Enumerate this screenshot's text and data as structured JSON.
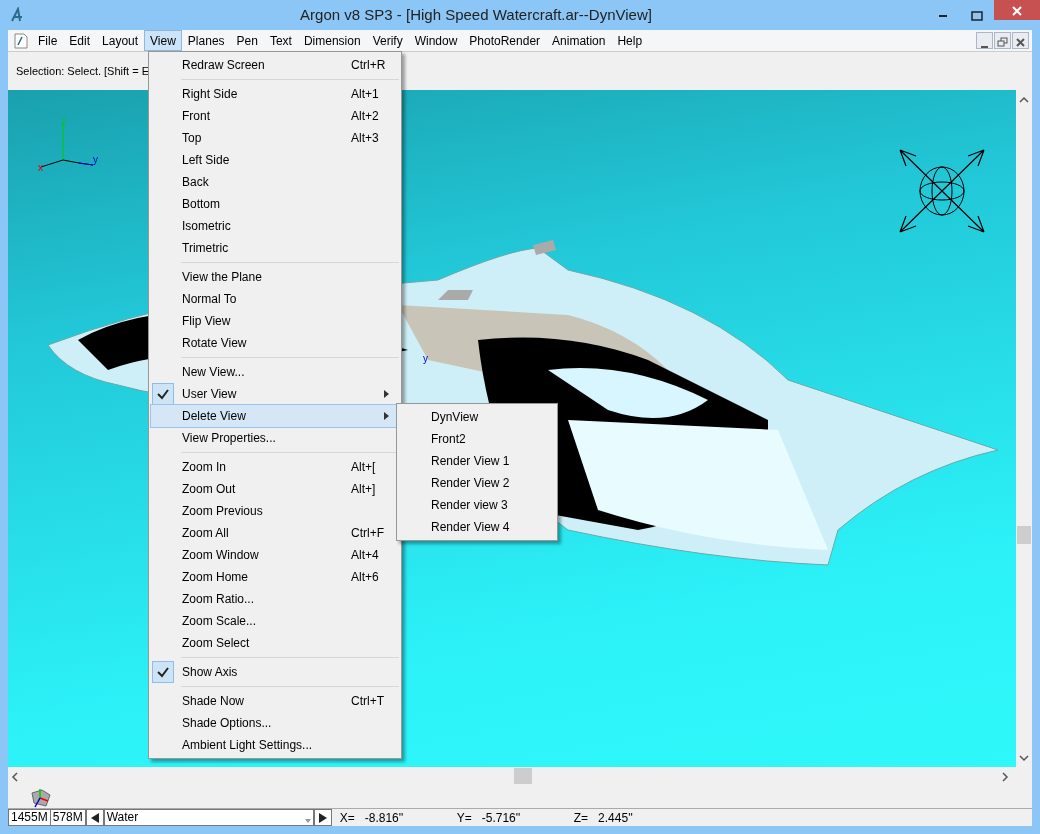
{
  "window": {
    "title": "Argon v8 SP3 - [High Speed Watercraft.ar--DynView]"
  },
  "menubar": [
    {
      "label": "File",
      "selected": false
    },
    {
      "label": "Edit",
      "selected": false
    },
    {
      "label": "Layout",
      "selected": false
    },
    {
      "label": "View",
      "selected": true
    },
    {
      "label": "Planes",
      "selected": false
    },
    {
      "label": "Pen",
      "selected": false
    },
    {
      "label": "Text",
      "selected": false
    },
    {
      "label": "Dimension",
      "selected": false
    },
    {
      "label": "Verify",
      "selected": false
    },
    {
      "label": "Window",
      "selected": false
    },
    {
      "label": "PhotoRender",
      "selected": false
    },
    {
      "label": "Animation",
      "selected": false
    },
    {
      "label": "Help",
      "selected": false
    }
  ],
  "prompt": "Selection: Select. [Shift = E",
  "view_menu": [
    {
      "kind": "item",
      "label": "Redraw Screen",
      "shortcut": "Ctrl+R",
      "checked": false,
      "highlighted": false,
      "submenu": false
    },
    {
      "kind": "separator"
    },
    {
      "kind": "item",
      "label": "Right Side",
      "shortcut": "Alt+1",
      "checked": false,
      "highlighted": false,
      "submenu": false
    },
    {
      "kind": "item",
      "label": "Front",
      "shortcut": "Alt+2",
      "checked": false,
      "highlighted": false,
      "submenu": false
    },
    {
      "kind": "item",
      "label": "Top",
      "shortcut": "Alt+3",
      "checked": false,
      "highlighted": false,
      "submenu": false
    },
    {
      "kind": "item",
      "label": "Left Side",
      "checked": false,
      "highlighted": false,
      "submenu": false
    },
    {
      "kind": "item",
      "label": "Back",
      "checked": false,
      "highlighted": false,
      "submenu": false
    },
    {
      "kind": "item",
      "label": "Bottom",
      "checked": false,
      "highlighted": false,
      "submenu": false
    },
    {
      "kind": "item",
      "label": "Isometric",
      "checked": false,
      "highlighted": false,
      "submenu": false
    },
    {
      "kind": "item",
      "label": "Trimetric",
      "checked": false,
      "highlighted": false,
      "submenu": false
    },
    {
      "kind": "separator"
    },
    {
      "kind": "item",
      "label": "View the Plane",
      "checked": false,
      "highlighted": false,
      "submenu": false
    },
    {
      "kind": "item",
      "label": "Normal To",
      "checked": false,
      "highlighted": false,
      "submenu": false
    },
    {
      "kind": "item",
      "label": "Flip View",
      "checked": false,
      "highlighted": false,
      "submenu": false
    },
    {
      "kind": "item",
      "label": "Rotate View",
      "checked": false,
      "highlighted": false,
      "submenu": false
    },
    {
      "kind": "separator"
    },
    {
      "kind": "item",
      "label": "New View...",
      "checked": false,
      "highlighted": false,
      "submenu": false
    },
    {
      "kind": "item",
      "label": "User View",
      "checked": true,
      "highlighted": false,
      "submenu": true
    },
    {
      "kind": "item",
      "label": "Delete View",
      "checked": false,
      "highlighted": true,
      "submenu": true
    },
    {
      "kind": "item",
      "label": "View Properties...",
      "checked": false,
      "highlighted": false,
      "submenu": false
    },
    {
      "kind": "separator"
    },
    {
      "kind": "item",
      "label": "Zoom In",
      "shortcut": "Alt+[",
      "checked": false,
      "highlighted": false,
      "submenu": false
    },
    {
      "kind": "item",
      "label": "Zoom Out",
      "shortcut": "Alt+]",
      "checked": false,
      "highlighted": false,
      "submenu": false
    },
    {
      "kind": "item",
      "label": "Zoom Previous",
      "checked": false,
      "highlighted": false,
      "submenu": false
    },
    {
      "kind": "item",
      "label": "Zoom All",
      "shortcut": "Ctrl+F",
      "checked": false,
      "highlighted": false,
      "submenu": false
    },
    {
      "kind": "item",
      "label": "Zoom Window",
      "shortcut": "Alt+4",
      "checked": false,
      "highlighted": false,
      "submenu": false
    },
    {
      "kind": "item",
      "label": "Zoom Home",
      "shortcut": "Alt+6",
      "checked": false,
      "highlighted": false,
      "submenu": false
    },
    {
      "kind": "item",
      "label": "Zoom Ratio...",
      "checked": false,
      "highlighted": false,
      "submenu": false
    },
    {
      "kind": "item",
      "label": "Zoom Scale...",
      "checked": false,
      "highlighted": false,
      "submenu": false
    },
    {
      "kind": "item",
      "label": "Zoom Select",
      "checked": false,
      "highlighted": false,
      "submenu": false
    },
    {
      "kind": "separator"
    },
    {
      "kind": "item",
      "label": "Show Axis",
      "checked": true,
      "highlighted": false,
      "submenu": false
    },
    {
      "kind": "separator"
    },
    {
      "kind": "item",
      "label": "Shade Now",
      "shortcut": "Ctrl+T",
      "checked": false,
      "highlighted": false,
      "submenu": false
    },
    {
      "kind": "item",
      "label": "Shade Options...",
      "checked": false,
      "highlighted": false,
      "submenu": false
    },
    {
      "kind": "item",
      "label": "Ambient Light Settings...",
      "checked": false,
      "highlighted": false,
      "submenu": false
    }
  ],
  "submenu": [
    "DynView",
    "Front2",
    "Render View 1",
    "Render View 2",
    "Render view 3",
    "Render View 4"
  ],
  "viewport": {
    "axis_labels": [
      "z",
      "x",
      "y"
    ],
    "model_label": "y"
  },
  "status_bar": {
    "memory_1": "1455M",
    "memory_2": "578M",
    "layer": "Water",
    "x_label": "X=",
    "x_value": "-8.816''",
    "y_label": "Y=",
    "y_value": "-5.716''",
    "z_label": "Z=",
    "z_value": "2.445''"
  }
}
